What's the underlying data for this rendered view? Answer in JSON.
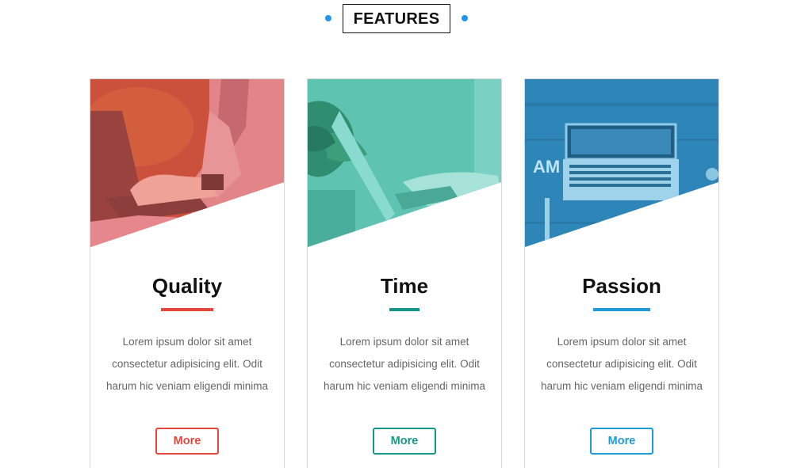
{
  "header": {
    "title": "FEATURES",
    "accent_color": "#2196e8"
  },
  "cards": [
    {
      "title": "Quality",
      "text": "Lorem ipsum dolor sit amet consectetur adipisicing elit. Odit harum hic veniam eligendi minima",
      "button_label": "More",
      "accent_color": "#e5473b",
      "image_subject": "person typing on laptop",
      "image_tint": "#e0584c"
    },
    {
      "title": "Time",
      "text": "Lorem ipsum dolor sit amet consectetur adipisicing elit. Odit harum hic veniam eligendi minima",
      "button_label": "More",
      "accent_color": "#169688",
      "image_subject": "hands on laptop next to plant",
      "image_tint": "#4fbfad"
    },
    {
      "title": "Passion",
      "text": "Lorem ipsum dolor sit amet consectetur adipisicing elit. Odit harum hic veniam eligendi minima",
      "button_label": "More",
      "accent_color": "#1e9bd7",
      "image_subject": "laptop on desk top view",
      "image_tint": "#2f86b7"
    }
  ]
}
